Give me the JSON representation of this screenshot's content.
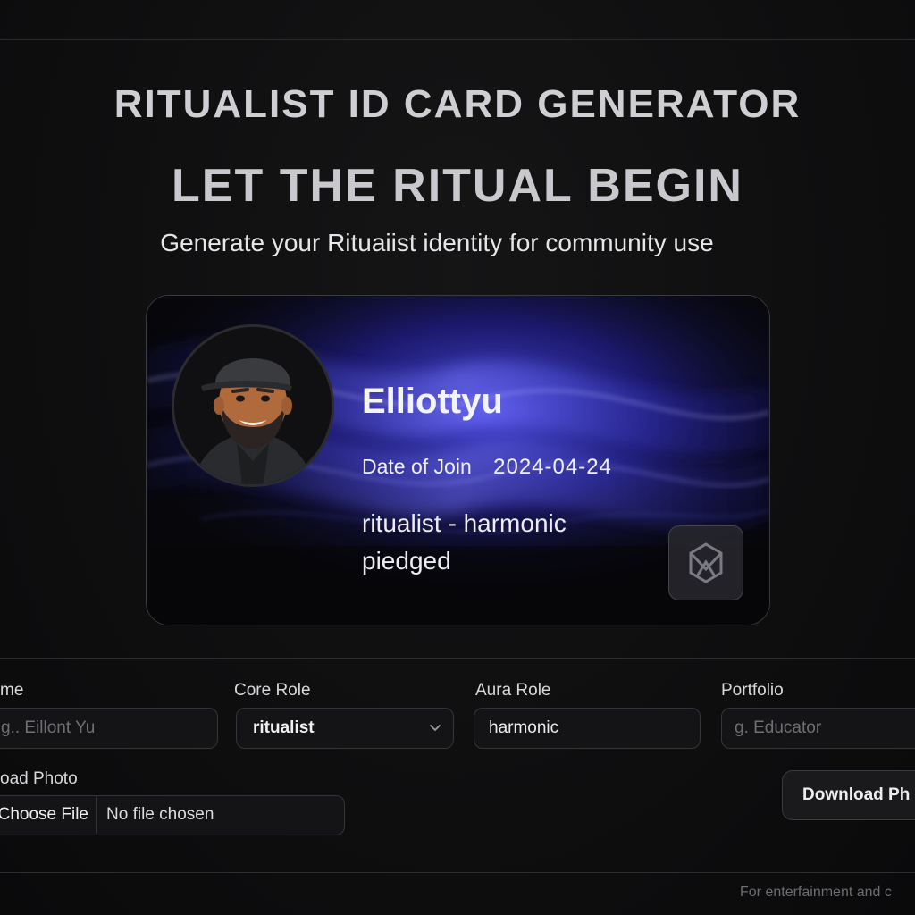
{
  "header": {
    "app_title": "RITUALIST ID CARD GENERATOR",
    "headline": "LET THE RITUAL BEGIN",
    "subtitle": "Generate your Rituaiist identity for community use"
  },
  "card": {
    "name": "Elliottyu",
    "join_label": "Date of Join",
    "join_date": "2024-04-24",
    "role_line_1": "ritualist - harmonic",
    "role_line_2": "piedged",
    "logo_icon": "ritual-logo-icon",
    "avatar_icon": "user-avatar-illustration"
  },
  "form": {
    "name_label": "me",
    "name_placeholder": "g.. Eillont Yu",
    "core_role_label": "Core Role",
    "core_role_value": "ritualist",
    "aura_role_label": "Aura Role",
    "aura_role_value": "harmonic",
    "portfolio_label": "Portfolio",
    "portfolio_placeholder": "g. Educator",
    "upload_label": "oad Photo",
    "choose_file": "Choose File",
    "file_status": "No file chosen",
    "download_label": "Download Ph"
  },
  "footer": {
    "note": "For enterfainment and c"
  },
  "colors": {
    "background": "#0f0f10",
    "card_glow": "#3d3df0",
    "field_border": "#34343a"
  }
}
